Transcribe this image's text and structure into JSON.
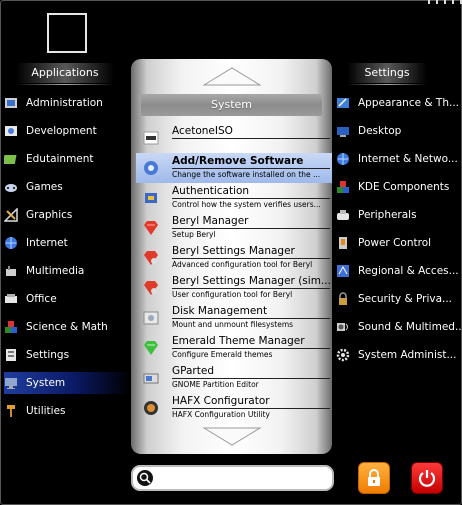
{
  "left_panel": {
    "heading": "Applications",
    "items": [
      {
        "label": "Administration",
        "icon": "admin-icon"
      },
      {
        "label": "Development",
        "icon": "development-icon"
      },
      {
        "label": "Edutainment",
        "icon": "edutainment-icon"
      },
      {
        "label": "Games",
        "icon": "gamepad-icon"
      },
      {
        "label": "Graphics",
        "icon": "graphics-icon"
      },
      {
        "label": "Internet",
        "icon": "globe-icon"
      },
      {
        "label": "Multimedia",
        "icon": "multimedia-icon"
      },
      {
        "label": "Office",
        "icon": "office-icon"
      },
      {
        "label": "Science & Math",
        "icon": "science-icon"
      },
      {
        "label": "Settings",
        "icon": "settings-icon"
      },
      {
        "label": "System",
        "icon": "monitor-icon",
        "active": true
      },
      {
        "label": "Utilities",
        "icon": "tools-icon"
      }
    ]
  },
  "center_panel": {
    "title": "System",
    "apps": [
      {
        "name": "AcetoneISO",
        "description": "",
        "icon": "acetoneiso-icon"
      },
      {
        "name": "Add/Remove Software",
        "description": "Change the software installed on the ...",
        "icon": "package-icon",
        "selected": true
      },
      {
        "name": "Authentication",
        "description": "Control how the system verifies users...",
        "icon": "authentication-icon"
      },
      {
        "name": "Beryl Manager",
        "description": "Setup Beryl",
        "icon": "beryl-icon"
      },
      {
        "name": "Beryl Settings Manager",
        "description": "Advanced configuration tool for Beryl",
        "icon": "beryl-settings-icon"
      },
      {
        "name": "Beryl Settings Manager (sim...",
        "description": "User configuration tool for Beryl",
        "icon": "beryl-settings-simple-icon"
      },
      {
        "name": "Disk Management",
        "description": "Mount and unmount filesystems",
        "icon": "disk-icon"
      },
      {
        "name": "Emerald Theme Manager",
        "description": "Configure Emerald themes",
        "icon": "emerald-icon"
      },
      {
        "name": "GParted",
        "description": "GNOME Partition Editor",
        "icon": "gparted-icon"
      },
      {
        "name": "HAFX Configurator",
        "description": "HAFX Configuration Utility",
        "icon": "hafx-icon"
      }
    ]
  },
  "right_panel": {
    "heading": "Settings",
    "items": [
      {
        "label": "Appearance & Th...",
        "icon": "appearance-icon"
      },
      {
        "label": "Desktop",
        "icon": "desktop-icon"
      },
      {
        "label": "Internet & Netwo...",
        "icon": "network-globe-icon"
      },
      {
        "label": "KDE Components",
        "icon": "kde-components-icon"
      },
      {
        "label": "Peripherals",
        "icon": "peripherals-icon"
      },
      {
        "label": "Power Control",
        "icon": "power-control-icon"
      },
      {
        "label": "Regional & Acces...",
        "icon": "regional-icon"
      },
      {
        "label": "Security & Priva...",
        "icon": "security-icon"
      },
      {
        "label": "Sound & Multimed...",
        "icon": "sound-icon"
      },
      {
        "label": "System Administ...",
        "icon": "gear-icon"
      }
    ]
  },
  "search": {
    "value": "",
    "placeholder": ""
  },
  "colors": {
    "accent": "#1f3d9e",
    "lock": "#f28a10",
    "power": "#e01010"
  }
}
